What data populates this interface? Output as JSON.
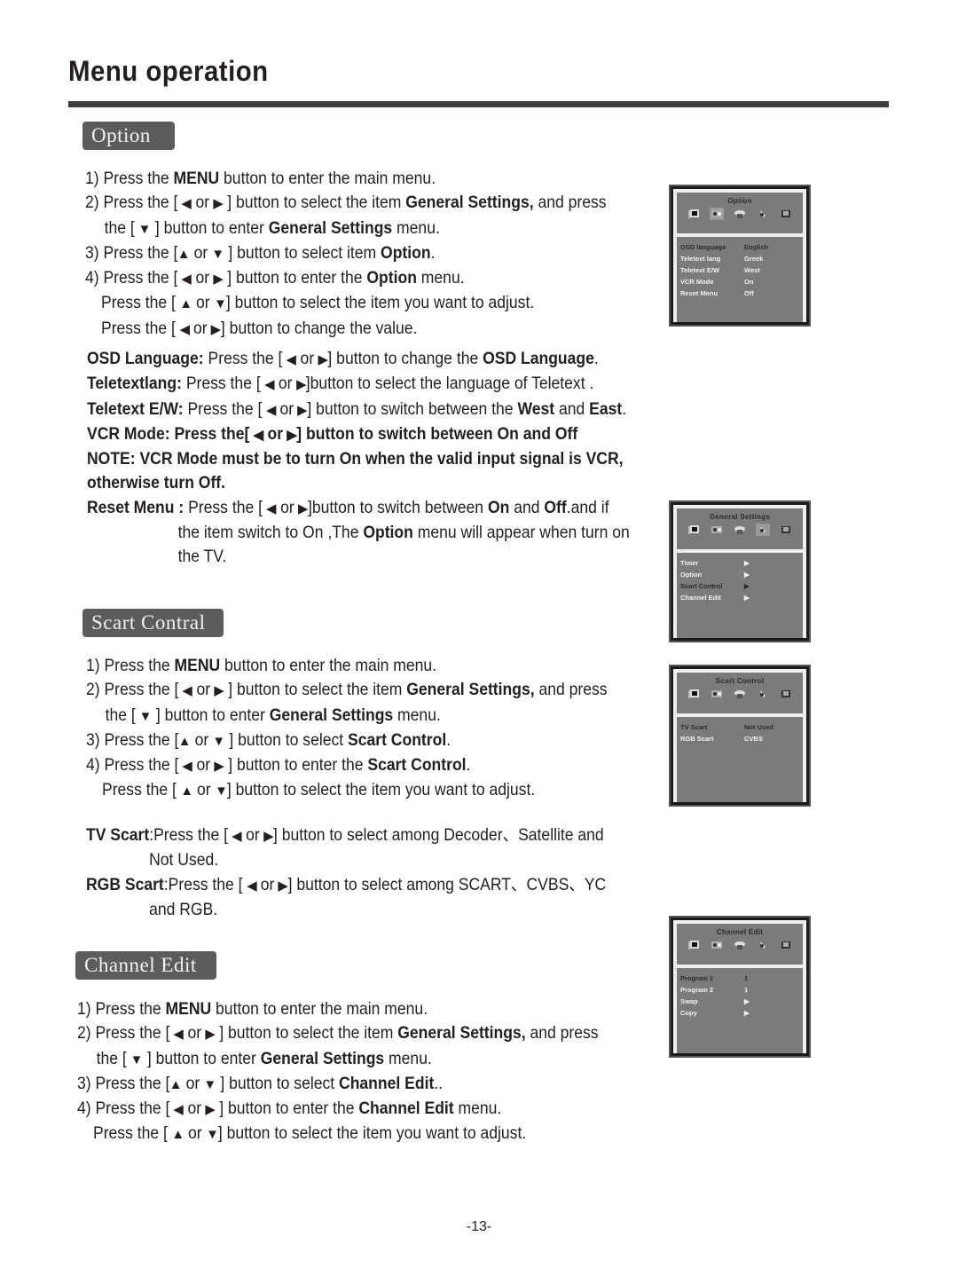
{
  "page": {
    "title": "Menu operation",
    "page_number": "-13-"
  },
  "glyphs": {
    "left": "◀",
    "right": "▶",
    "up": "▲",
    "down": "▼",
    "or": "or"
  },
  "option": {
    "heading": "Option",
    "steps": {
      "s1_a": "1) Press the ",
      "s1_b": "MENU",
      "s1_c": " button to enter the main menu.",
      "s2_a": "2) Press the [",
      "s2_c": "] button to select the item ",
      "s2_d": "General Settings,",
      "s2_e": " and press",
      "s2b_a": "the [",
      "s2b_c": "] button to enter ",
      "s2b_d": "General Settings",
      "s2b_e": " menu.",
      "s3_a": "3) Press the [",
      "s3_c": "] button to select item ",
      "s3_d": "Option",
      "s3_e": ".",
      "s4_a": "4) Press the [",
      "s4_c": "] button to enter the ",
      "s4_d": "Option",
      "s4_e": " menu.",
      "s5_a": "Press the [",
      "s5_c": "] button to select the item you want to adjust.",
      "s6_a": "Press the [",
      "s6_c": "] button to change the value."
    },
    "desc": {
      "osd_label": "OSD Language:",
      "osd_a": " Press the [",
      "osd_c": "] button to change the ",
      "osd_d": "OSD Language",
      "osd_e": ".",
      "tl_label": "Teletextlang:",
      "tl_a": " Press the [",
      "tl_c": "]button to select the language of Teletext .",
      "tew_label": "Teletext E/W:",
      "tew_a": " Press the [",
      "tew_c": "] button to switch between the ",
      "tew_d": "West",
      "tew_e": " and ",
      "tew_f": "East",
      "tew_g": ".",
      "vcr_a": "VCR Mode: Press the[",
      "vcr_c": "] button to switch between On and Off",
      "note_1": "NOTE:   VCR Mode must be to turn On when the valid input signal is VCR,",
      "note_2": "otherwise turn Off.",
      "reset_label": "Reset Menu :",
      "reset_a": " Press the [",
      "reset_c": "]button to switch between ",
      "reset_d": "On",
      "reset_e": " and ",
      "reset_f": "Off",
      "reset_g": ".and if",
      "reset_2a": "the item switch to On ,The ",
      "reset_2b": "Option",
      "reset_2c": " menu will appear when turn on",
      "reset_3": "the TV."
    },
    "osd": {
      "title": "Option",
      "rows": [
        {
          "key": "OSD language",
          "value": "English",
          "highlighted": true
        },
        {
          "key": "Teletext lang",
          "value": "Greek"
        },
        {
          "key": "Teletext E/W",
          "value": "West"
        },
        {
          "key": "VCR Mode",
          "value": "On"
        },
        {
          "key": "Reset Menu",
          "value": "Off"
        }
      ]
    }
  },
  "general_settings_osd": {
    "title": "General Settings",
    "rows": [
      {
        "key": "Timer",
        "value": "▶"
      },
      {
        "key": "Option",
        "value": "▶"
      },
      {
        "key": "Scart Control",
        "value": "▶",
        "highlighted": true
      },
      {
        "key": "Channel Edit",
        "value": "▶"
      }
    ]
  },
  "scart": {
    "heading": "Scart Contral",
    "steps": {
      "s1_a": "1) Press the ",
      "s1_b": "MENU",
      "s1_c": " button to enter the main menu.",
      "s2_a": "2) Press the [",
      "s2_c": "] button to select the item ",
      "s2_d": "General Settings,",
      "s2_e": " and press",
      "s2b_a": "the [",
      "s2b_c": "] button to enter ",
      "s2b_d": "General Settings",
      "s2b_e": " menu.",
      "s3_a": "3) Press the [",
      "s3_c": "] button to select ",
      "s3_d": "Scart Control",
      "s3_e": ".",
      "s4_a": "4) Press the [",
      "s4_c": "] button to enter the ",
      "s4_d": "Scart Control",
      "s4_e": ".",
      "s5_a": "Press the [",
      "s5_c": "] button to select the item you want to adjust."
    },
    "desc": {
      "tv_label": "TV Scart",
      "tv_a": ":Press the [",
      "tv_c": "] button to select among Decoder、Satellite and",
      "tv_2": "Not Used.",
      "rgb_label": "RGB Scart",
      "rgb_a": ":Press the [",
      "rgb_c": "] button to select among SCART、CVBS、YC",
      "rgb_2": "and RGB."
    },
    "osd": {
      "title": "Scart Control",
      "rows": [
        {
          "key": "TV Scart",
          "value": "Not Used",
          "highlighted": true
        },
        {
          "key": "RGB Scart",
          "value": "CVBS"
        }
      ]
    }
  },
  "channel": {
    "heading": "Channel Edit",
    "steps": {
      "s1_a": "1) Press the ",
      "s1_b": "MENU",
      "s1_c": " button to enter the main menu.",
      "s2_a": "2) Press the [",
      "s2_c": "] button to select the item ",
      "s2_d": "General Settings,",
      "s2_e": " and press",
      "s2b_a": "the [",
      "s2b_c": "] button to enter ",
      "s2b_d": "General Settings",
      "s2b_e": " menu.",
      "s3_a": "3) Press the [",
      "s3_c": "] button to select ",
      "s3_d": "Channel Edit",
      "s3_e": "..",
      "s4_a": "4) Press the [",
      "s4_c": "] button to enter the ",
      "s4_d": "Channel Edit",
      "s4_e": " menu.",
      "s5_a": "Press the [",
      "s5_c": "] button to select the item you want to adjust."
    },
    "osd": {
      "title": "Channel Edit",
      "rows": [
        {
          "key": "Program  1",
          "value": "1",
          "highlighted": true
        },
        {
          "key": "Program  2",
          "value": "1"
        },
        {
          "key": "Swap",
          "value": "▶"
        },
        {
          "key": "Copy",
          "value": "▶"
        }
      ]
    }
  }
}
